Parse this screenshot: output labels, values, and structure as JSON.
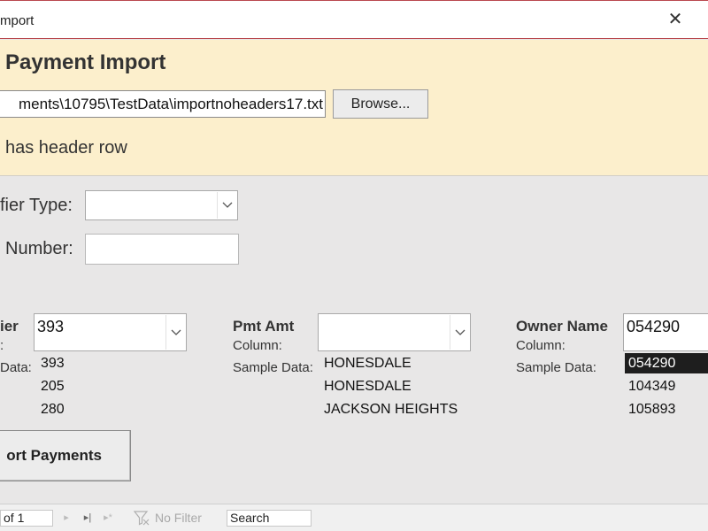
{
  "window": {
    "title": "mport",
    "close_glyph": "✕"
  },
  "header": {
    "form_title": "Payment Import",
    "file_path": "ments\\10795\\TestData\\importnoheaders17.txt",
    "browse_label": "Browse...",
    "header_row_label": "has header row"
  },
  "identifier_type": {
    "label": "fier Type:",
    "value": ""
  },
  "number": {
    "label": "Number:",
    "value": ""
  },
  "columns": {
    "identifier": {
      "title": "ier",
      "column_label": ":",
      "sample_label": "Data:",
      "selected": "393",
      "samples": [
        "393",
        "205",
        "280"
      ]
    },
    "pmt_amt": {
      "title": "Pmt Amt",
      "column_label": "Column:",
      "sample_label": "Sample Data:",
      "selected": "",
      "samples": [
        "HONESDALE",
        "HONESDALE",
        "JACKSON HEIGHTS"
      ]
    },
    "owner_name": {
      "title": "Owner Name",
      "column_label": "Column:",
      "sample_label": "Sample Data:",
      "selected": "054290",
      "samples": [
        "054290",
        "104349",
        "105893"
      ]
    }
  },
  "import_button": "ort Payments",
  "navigation": {
    "record_text": "of 1",
    "next_glyph": "▸",
    "last_glyph": "▸|",
    "new_glyph": "▸*",
    "no_filter_label": "No Filter",
    "search_placeholder": "Search"
  },
  "colors": {
    "header_bg": "#fcefcc",
    "body_bg": "#e8e7e7",
    "accent_border": "#b9484f",
    "selected_row_bg": "#1e1e1e"
  }
}
